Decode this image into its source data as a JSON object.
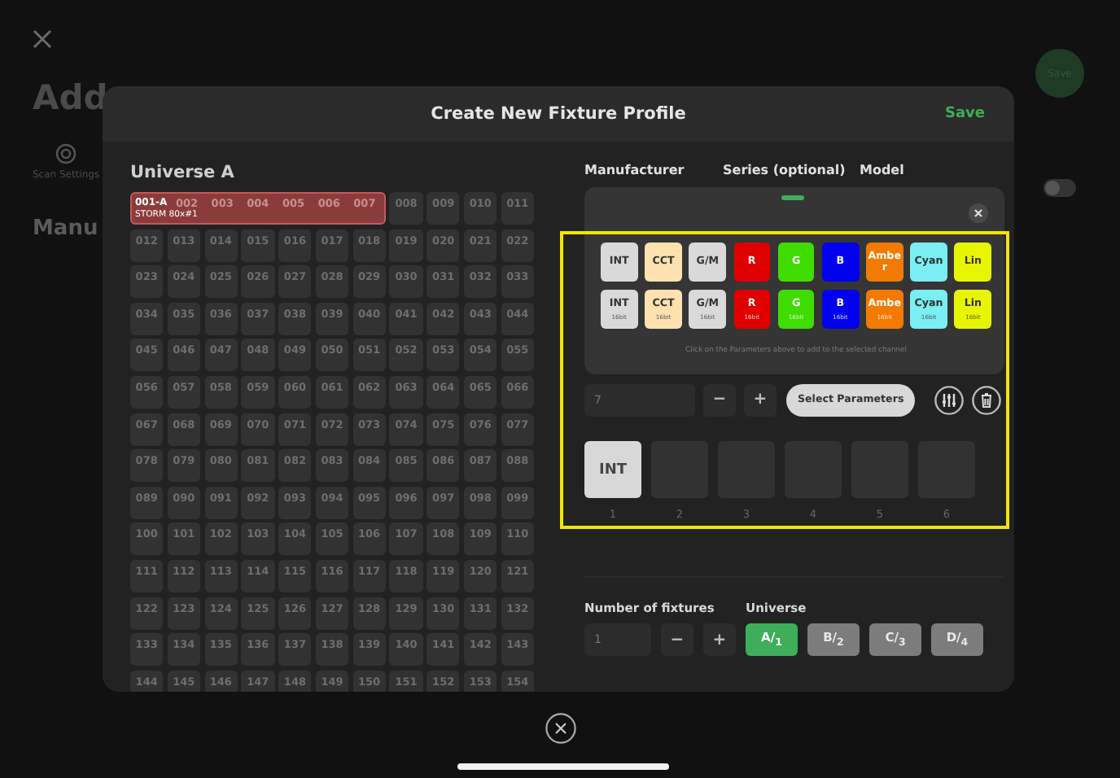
{
  "background": {
    "title": "Add",
    "tab": "Scan Settings",
    "section": "Manu",
    "save": "Save",
    "toggle": {
      "on": false
    }
  },
  "modal": {
    "title": "Create New Fixture Profile",
    "save": "Save"
  },
  "universe": {
    "title": "Universe A",
    "patch": {
      "label": "001-A",
      "fixture": "STORM 80x#1",
      "cells": [
        "002",
        "003",
        "004",
        "005",
        "006",
        "007"
      ]
    },
    "cells": [
      "008",
      "009",
      "010",
      "011",
      "012",
      "013",
      "014",
      "015",
      "016",
      "017",
      "018",
      "019",
      "020",
      "021",
      "022",
      "023",
      "024",
      "025",
      "026",
      "027",
      "028",
      "029",
      "030",
      "031",
      "032",
      "033",
      "034",
      "035",
      "036",
      "037",
      "038",
      "039",
      "040",
      "041",
      "042",
      "043",
      "044",
      "045",
      "046",
      "047",
      "048",
      "049",
      "050",
      "051",
      "052",
      "053",
      "054",
      "055",
      "056",
      "057",
      "058",
      "059",
      "060",
      "061",
      "062",
      "063",
      "064",
      "065",
      "066",
      "067",
      "068",
      "069",
      "070",
      "071",
      "072",
      "073",
      "074",
      "075",
      "076",
      "077",
      "078",
      "079",
      "080",
      "081",
      "082",
      "083",
      "084",
      "085",
      "086",
      "087",
      "088",
      "089",
      "090",
      "091",
      "092",
      "093",
      "094",
      "095",
      "096",
      "097",
      "098",
      "099",
      "100",
      "101",
      "102",
      "103",
      "104",
      "105",
      "106",
      "107",
      "108",
      "109",
      "110",
      "111",
      "112",
      "113",
      "114",
      "115",
      "116",
      "117",
      "118",
      "119",
      "120",
      "121",
      "122",
      "123",
      "124",
      "125",
      "126",
      "127",
      "128",
      "129",
      "130",
      "131",
      "132",
      "133",
      "134",
      "135",
      "136",
      "137",
      "138",
      "139",
      "140",
      "141",
      "142",
      "143",
      "144",
      "145",
      "146",
      "147",
      "148",
      "149",
      "150",
      "151",
      "152",
      "153",
      "154"
    ]
  },
  "form": {
    "columns": [
      "Manufacturer",
      "Series (optional)",
      "Model"
    ]
  },
  "parameter_picker": {
    "hint": "Click on the Parameters above to add to the selected channel",
    "rows": [
      {
        "tiles": [
          {
            "label": "INT",
            "color": "#d9d9d9"
          },
          {
            "label": "CCT",
            "color": "#fde2b0"
          },
          {
            "label": "G/M",
            "color": "#d9d9d9"
          },
          {
            "label": "R",
            "color": "#e00000"
          },
          {
            "label": "G",
            "color": "#3fdc00"
          },
          {
            "label": "B",
            "color": "#0000ee"
          },
          {
            "label": "Amber",
            "color": "#f27a00"
          },
          {
            "label": "Cyan",
            "color": "#7aeef2"
          },
          {
            "label": "Lin",
            "color": "#e8f500"
          }
        ]
      },
      {
        "tiles": [
          {
            "label": "INT",
            "sub": "16bit",
            "color": "#d9d9d9"
          },
          {
            "label": "CCT",
            "sub": "16bit",
            "color": "#fde2b0"
          },
          {
            "label": "G/M",
            "sub": "16bit",
            "color": "#d9d9d9"
          },
          {
            "label": "R",
            "sub": "16bit",
            "color": "#e00000"
          },
          {
            "label": "G",
            "sub": "16bit",
            "color": "#3fdc00"
          },
          {
            "label": "B",
            "sub": "16bit",
            "color": "#0000ee"
          },
          {
            "label": "Ambe",
            "sub": "16bit",
            "color": "#f27a00"
          },
          {
            "label": "Cyan",
            "sub": "16bit",
            "color": "#7aeef2"
          },
          {
            "label": "Lin",
            "sub": "16bit",
            "color": "#e8f500"
          }
        ]
      }
    ]
  },
  "channels": {
    "count": "7",
    "decrement": "−",
    "increment": "+",
    "select": "Select Parameters",
    "slots": [
      {
        "number": "1",
        "param": "INT"
      },
      {
        "number": "2"
      },
      {
        "number": "3"
      },
      {
        "number": "4"
      },
      {
        "number": "5"
      },
      {
        "number": "6"
      }
    ]
  },
  "fixtures": {
    "label": "Number of fixtures",
    "value": "1",
    "decrement": "−",
    "increment": "+"
  },
  "universe_picker": {
    "label": "Universe",
    "options": [
      {
        "label": "A/$_{1}$",
        "selected": true
      },
      {
        "label": "B/$_{2}$",
        "selected": false
      },
      {
        "label": "C/$_{3}$",
        "selected": false
      },
      {
        "label": "D/$_{4}$",
        "selected": false
      }
    ]
  }
}
